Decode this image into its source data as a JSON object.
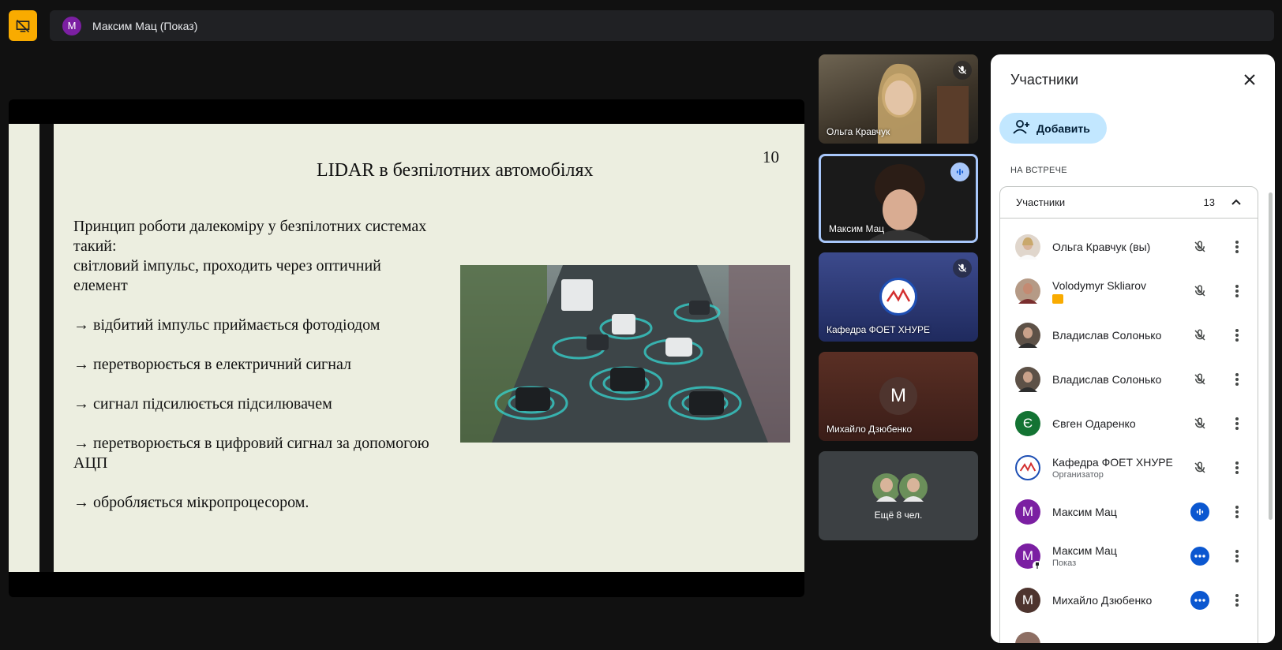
{
  "topbar": {
    "presenter_initial": "M",
    "title": "Максим Мац (Показ)",
    "icon": "presentation-off-icon"
  },
  "slide": {
    "number": "10",
    "title": "LIDAR в безпілотних автомобілях",
    "paragraphs": [
      "Принцип роботи далекоміру у безпілотних системах такий: світловий імпульс, проходить через оптичний елемент",
      "→ відбитий імпульс приймається фотодіодом",
      "→ перетворюється в електричний сигнал",
      "→  сигнал підсилюється підсилювачем",
      "→ перетворюється в цифровий сигнал за допомогою АЦП",
      "→ обробляється мікропроцесором."
    ],
    "line1": "Принцип роботи далекоміру у безпілотних системах",
    "line2": "такий:",
    "line3": "світловий імпульс, проходить через оптичний",
    "line4": "елемент"
  },
  "tiles": [
    {
      "name": "Ольга Кравчук",
      "status": "muted"
    },
    {
      "name": "Максим Мац",
      "status": "speaking"
    },
    {
      "name": "Кафедра ФОЕТ ХНУРЕ",
      "status": "muted"
    },
    {
      "name": "Михайло Дзюбенко",
      "initial": "M"
    },
    {
      "name": "Ещё 8 чел."
    }
  ],
  "panel": {
    "title": "Участники",
    "add_label": "Добавить",
    "section_label": "НА ВСТРЕЧЕ",
    "group_label": "Участники",
    "group_count": "13",
    "participants": [
      {
        "name": "Ольга Кравчук (вы)",
        "sub": "",
        "initial": "",
        "mic": "muted"
      },
      {
        "name": "Volodymyr Skliarov",
        "sub": "",
        "initial": "",
        "mic": "muted"
      },
      {
        "name": "Владислав Солонько",
        "sub": "",
        "initial": "",
        "mic": "muted"
      },
      {
        "name": "Владислав Солонько",
        "sub": "",
        "initial": "",
        "mic": "muted"
      },
      {
        "name": "Євген Одаренко",
        "sub": "",
        "initial": "Є",
        "mic": "muted"
      },
      {
        "name": "Кафедра ФОЕТ ХНУРЕ",
        "sub": "Организатор",
        "initial": "",
        "mic": "muted"
      },
      {
        "name": "Максим Мац",
        "sub": "",
        "initial": "M",
        "mic": "speaking"
      },
      {
        "name": "Максим Мац",
        "sub": "Показ",
        "initial": "M",
        "mic": "more"
      },
      {
        "name": "Михайло Дзюбенко",
        "sub": "",
        "initial": "M",
        "mic": "more"
      }
    ]
  },
  "colors": {
    "accent_purple": "#7b1fa2",
    "accent_green": "#137333",
    "speaking_blue": "#0b57d0",
    "add_button_bg": "#c2e7ff",
    "logo_bg": "#f9ab00"
  }
}
